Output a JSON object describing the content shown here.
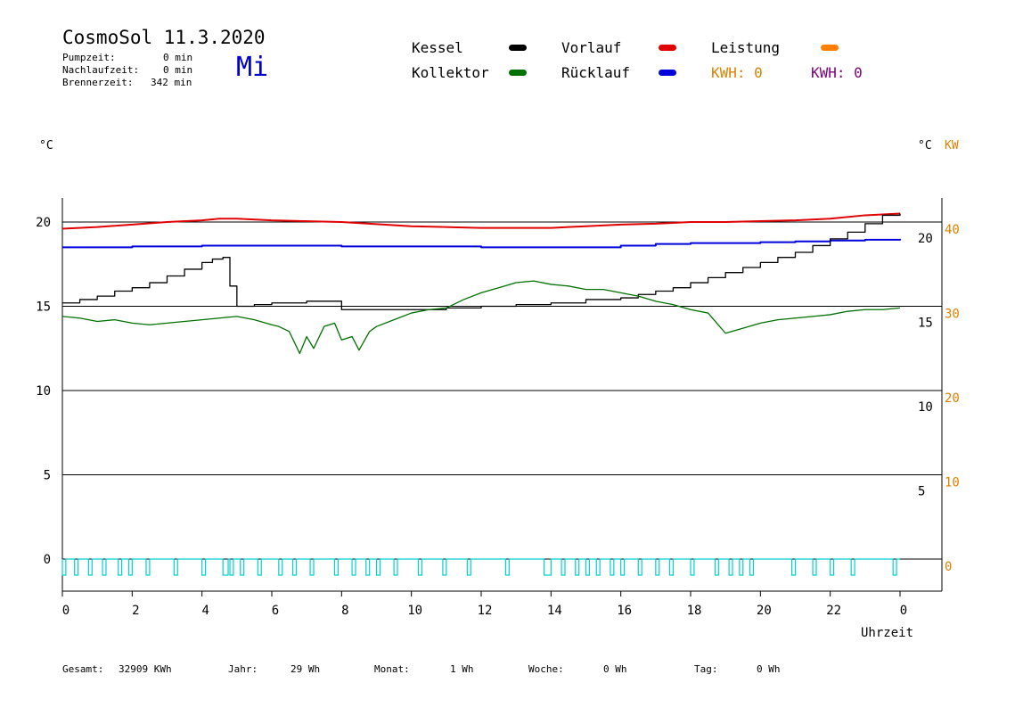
{
  "header": {
    "title": "CosmoSol 11.3.2020",
    "day": "Mi",
    "pumpzeit_label": "Pumpzeit:",
    "pumpzeit_value": "0 min",
    "nachlauf_label": "Nachlaufzeit:",
    "nachlauf_value": "0 min",
    "brenner_label": "Brennerzeit:",
    "brenner_value": "342 min"
  },
  "legend": {
    "kessel": "Kessel",
    "kollektor": "Kollektor",
    "vorlauf": "Vorlauf",
    "ruecklauf": "Rücklauf",
    "leistung": "Leistung",
    "kwh1": "KWH: 0",
    "kwh2": "KWH: 0"
  },
  "axes": {
    "left_unit": "°C",
    "right_unit_c": "°C",
    "right_unit_kw": "KW",
    "xlabel": "Uhrzeit"
  },
  "colors": {
    "kessel": "#000000",
    "kollektor": "#007000",
    "vorlauf": "#e00000",
    "ruecklauf": "#0000dd",
    "leistung": "#ff8000",
    "kwh1": "#e08000",
    "kwh2": "#800080",
    "pump": "#00d0d0",
    "kw_axis": "#e08000"
  },
  "footer": {
    "gesamt_label": "Gesamt:",
    "gesamt_value": "32909 KWh",
    "jahr_label": "Jahr:",
    "jahr_value": "29 Wh",
    "monat_label": "Monat:",
    "monat_value": "1 Wh",
    "woche_label": "Woche:",
    "woche_value": "0 Wh",
    "tag_label": "Tag:",
    "tag_value": "0 Wh"
  },
  "chart_data": {
    "type": "line",
    "xlabel": "Uhrzeit",
    "ylabel": "°C",
    "xlim": [
      0,
      24
    ],
    "ylim": [
      0,
      20
    ],
    "y_right_kw_lim": [
      0,
      40
    ],
    "x_ticks": [
      "0",
      "2",
      "4",
      "6",
      "8",
      "10",
      "12",
      "14",
      "16",
      "18",
      "20",
      "22",
      "0"
    ],
    "y_ticks_left": [
      "0",
      "5",
      "10",
      "15",
      "20"
    ],
    "y_ticks_right_c": [
      "5",
      "10",
      "15",
      "20"
    ],
    "y_ticks_right_kw": [
      "0",
      "10",
      "20",
      "30",
      "40"
    ],
    "grid": true,
    "series": [
      {
        "name": "Vorlauf",
        "color": "#e00000",
        "x": [
          0,
          1,
          2,
          3,
          4,
          4.5,
          5,
          6,
          8,
          10,
          11,
          12,
          13,
          14,
          15,
          16,
          17,
          18,
          19,
          20,
          21,
          22,
          23,
          23.5,
          24
        ],
        "y": [
          19.6,
          19.7,
          19.85,
          20.0,
          20.1,
          20.2,
          20.2,
          20.1,
          20.0,
          19.75,
          19.7,
          19.65,
          19.65,
          19.65,
          19.75,
          19.85,
          19.9,
          20.0,
          20.0,
          20.05,
          20.1,
          20.2,
          20.4,
          20.45,
          20.5
        ]
      },
      {
        "name": "Rücklauf",
        "color": "#0000dd",
        "x": [
          0,
          2,
          4,
          6,
          8,
          10,
          12,
          14,
          16,
          17,
          18,
          19,
          20,
          21,
          22,
          23,
          24
        ],
        "y": [
          18.5,
          18.55,
          18.6,
          18.6,
          18.55,
          18.55,
          18.5,
          18.5,
          18.6,
          18.7,
          18.75,
          18.75,
          18.8,
          18.85,
          18.9,
          18.95,
          19.0
        ],
        "step": true
      },
      {
        "name": "Kessel",
        "color": "#000000",
        "x": [
          0,
          0.5,
          1,
          1.5,
          2,
          2.5,
          3,
          3.5,
          4,
          4.3,
          4.6,
          4.8,
          5,
          5.5,
          6,
          6.5,
          7,
          7.5,
          8,
          8.5,
          9,
          10,
          11,
          12,
          13,
          14,
          15,
          16,
          16.5,
          17,
          17.5,
          18,
          18.5,
          19,
          19.5,
          20,
          20.5,
          21,
          21.5,
          22,
          22.5,
          23,
          23.5,
          24
        ],
        "y": [
          15.2,
          15.4,
          15.6,
          15.9,
          16.1,
          16.4,
          16.8,
          17.2,
          17.6,
          17.8,
          17.9,
          16.2,
          15.0,
          15.1,
          15.2,
          15.2,
          15.3,
          15.3,
          14.8,
          14.8,
          14.8,
          14.8,
          14.9,
          15.0,
          15.1,
          15.2,
          15.4,
          15.5,
          15.7,
          15.9,
          16.1,
          16.4,
          16.7,
          17.0,
          17.3,
          17.6,
          17.9,
          18.2,
          18.6,
          19.0,
          19.4,
          19.9,
          20.4,
          20.5
        ],
        "step": true
      },
      {
        "name": "Kollektor",
        "color": "#007000",
        "x": [
          0,
          0.5,
          1,
          1.5,
          2,
          2.5,
          3,
          3.5,
          4,
          4.5,
          5,
          5.5,
          6,
          6.2,
          6.5,
          6.8,
          7,
          7.2,
          7.5,
          7.8,
          8,
          8.3,
          8.5,
          8.8,
          9,
          9.5,
          10,
          10.5,
          11,
          11.5,
          12,
          12.5,
          13,
          13.5,
          14,
          14.5,
          15,
          15.5,
          16,
          16.5,
          17,
          17.5,
          18,
          18.5,
          19,
          19.5,
          20,
          20.5,
          21,
          21.5,
          22,
          22.5,
          23,
          23.5,
          24
        ],
        "y": [
          14.4,
          14.3,
          14.1,
          14.2,
          14.0,
          13.9,
          14.0,
          14.1,
          14.2,
          14.3,
          14.4,
          14.2,
          13.9,
          13.8,
          13.5,
          12.2,
          13.2,
          12.5,
          13.8,
          14.0,
          13.0,
          13.2,
          12.4,
          13.5,
          13.8,
          14.2,
          14.6,
          14.8,
          14.9,
          15.4,
          15.8,
          16.1,
          16.4,
          16.5,
          16.3,
          16.2,
          16.0,
          16.0,
          15.8,
          15.6,
          15.3,
          15.1,
          14.8,
          14.6,
          13.4,
          13.7,
          14.0,
          14.2,
          14.3,
          14.4,
          14.5,
          14.7,
          14.8,
          14.8,
          14.9
        ]
      },
      {
        "name": "Pumpe",
        "color": "#00d0d0",
        "on_intervals": [
          [
            0.0,
            0.1
          ],
          [
            0.35,
            0.45
          ],
          [
            0.75,
            0.85
          ],
          [
            1.15,
            1.25
          ],
          [
            1.6,
            1.7
          ],
          [
            1.9,
            2.0
          ],
          [
            2.4,
            2.5
          ],
          [
            3.2,
            3.3
          ],
          [
            4.0,
            4.1
          ],
          [
            4.6,
            4.75
          ],
          [
            4.8,
            4.9
          ],
          [
            5.1,
            5.2
          ],
          [
            5.6,
            5.7
          ],
          [
            6.2,
            6.3
          ],
          [
            6.6,
            6.7
          ],
          [
            7.1,
            7.2
          ],
          [
            7.8,
            7.9
          ],
          [
            8.3,
            8.4
          ],
          [
            8.7,
            8.8
          ],
          [
            9.0,
            9.1
          ],
          [
            9.5,
            9.6
          ],
          [
            10.2,
            10.3
          ],
          [
            10.9,
            11.0
          ],
          [
            11.6,
            11.7
          ],
          [
            12.7,
            12.8
          ],
          [
            13.8,
            14.0
          ],
          [
            14.3,
            14.4
          ],
          [
            14.7,
            14.8
          ],
          [
            15.0,
            15.1
          ],
          [
            15.3,
            15.4
          ],
          [
            15.7,
            15.8
          ],
          [
            16.0,
            16.1
          ],
          [
            16.5,
            16.6
          ],
          [
            17.0,
            17.1
          ],
          [
            17.4,
            17.5
          ],
          [
            18.0,
            18.1
          ],
          [
            18.7,
            18.8
          ],
          [
            19.1,
            19.2
          ],
          [
            19.4,
            19.5
          ],
          [
            19.7,
            19.8
          ],
          [
            20.9,
            21.0
          ],
          [
            21.5,
            21.6
          ],
          [
            22.0,
            22.1
          ],
          [
            22.6,
            22.7
          ],
          [
            23.8,
            23.9
          ]
        ]
      }
    ]
  }
}
